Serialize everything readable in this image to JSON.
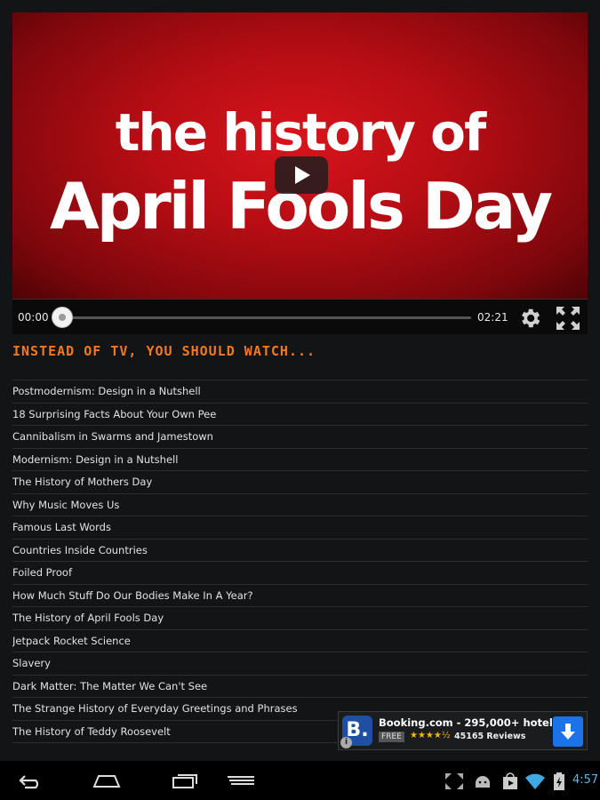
{
  "video": {
    "title_line1": "the history of",
    "title_line2": "April Fools Day",
    "current_time": "00:00",
    "duration": "02:21",
    "progress": 0
  },
  "section_heading": "INSTEAD OF TV, YOU SHOULD WATCH...",
  "related_videos": [
    "Postmodernism: Design in a Nutshell",
    "18 Surprising Facts About Your Own Pee",
    "Cannibalism in Swarms and Jamestown",
    "Modernism: Design in a Nutshell",
    "The History of Mothers Day",
    "Why Music Moves Us",
    "Famous Last Words",
    "Countries Inside Countries",
    "Foiled Proof",
    "How Much Stuff Do Our Bodies Make In A Year?",
    "The History of April Fools Day",
    "Jetpack Rocket Science",
    "Slavery",
    "Dark Matter: The Matter We Can't See",
    "The Strange History of Everyday Greetings and Phrases",
    "The History of Teddy Roosevelt"
  ],
  "ad": {
    "logo_letter": "B.",
    "title": "Booking.com - 295,000+ hotels",
    "price_badge": "FREE",
    "stars": "★★★★½",
    "reviews": "45165 Reviews",
    "info": "i"
  },
  "system": {
    "clock": "4:57"
  },
  "colors": {
    "accent": "#f47920",
    "clock": "#5fb6e6",
    "video_red": "#c8101a"
  }
}
